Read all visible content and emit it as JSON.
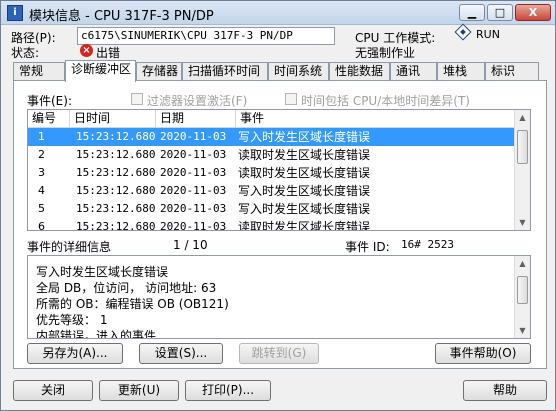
{
  "window": {
    "title": "模块信息 - CPU 317F-3 PN/DP",
    "minimize": "▁",
    "maximize": "□",
    "close": "X"
  },
  "header": {
    "path_label": "路径(P):",
    "path_value": "c6175\\SINUMERIK\\CPU 317F-3 PN/DP",
    "status_label": "状态:",
    "status_value": "出错",
    "cpu_mode_label": "CPU 工作模式:",
    "cpu_mode_value": "RUN",
    "force_status": "无强制作业"
  },
  "tabs": [
    "常规",
    "诊断缓冲区",
    "存储器",
    "扫描循环时间",
    "时间系统",
    "性能数据",
    "通讯",
    "堆栈",
    "标识"
  ],
  "events": {
    "label": "事件(E):",
    "filter_label": "过滤器设置激活(F)",
    "include_label": "时间包括 CPU/本地时间差异(T)",
    "columns": [
      "编号",
      "日时间",
      "日期",
      "事件"
    ],
    "rows": [
      {
        "no": "1",
        "time": "15:23:12.680",
        "date": "2020-11-03",
        "event": "写入时发生区域长度错误"
      },
      {
        "no": "2",
        "time": "15:23:12.680",
        "date": "2020-11-03",
        "event": "读取时发生区域长度错误"
      },
      {
        "no": "3",
        "time": "15:23:12.680",
        "date": "2020-11-03",
        "event": "读取时发生区域长度错误"
      },
      {
        "no": "4",
        "time": "15:23:12.680",
        "date": "2020-11-03",
        "event": "写入时发生区域长度错误"
      },
      {
        "no": "5",
        "time": "15:23:12.680",
        "date": "2020-11-03",
        "event": "写入时发生区域长度错误"
      },
      {
        "no": "6",
        "time": "15:23:12.680",
        "date": "2020-11-03",
        "event": "读取时发生区域长度错误"
      }
    ]
  },
  "details": {
    "label": "事件的详细信息",
    "position": "1 / 10",
    "event_id_label": "事件 ID:",
    "event_id_value": "16# 2523",
    "lines": [
      "写入时发生区域长度错误",
      "全局 DB，位访问，  访问地址:       63",
      "所需的 OB：编程错误 OB (OB121)",
      "优先等级：   1",
      "内部错误，进入的事件"
    ]
  },
  "panel_buttons": {
    "save_as": "另存为(A)...",
    "settings": "设置(S)...",
    "goto": "跳转到(G)",
    "event_help": "事件帮助(O)"
  },
  "footer_buttons": {
    "close": "关闭",
    "update": "更新(U)",
    "print": "打印(P)...",
    "help": "帮助"
  }
}
